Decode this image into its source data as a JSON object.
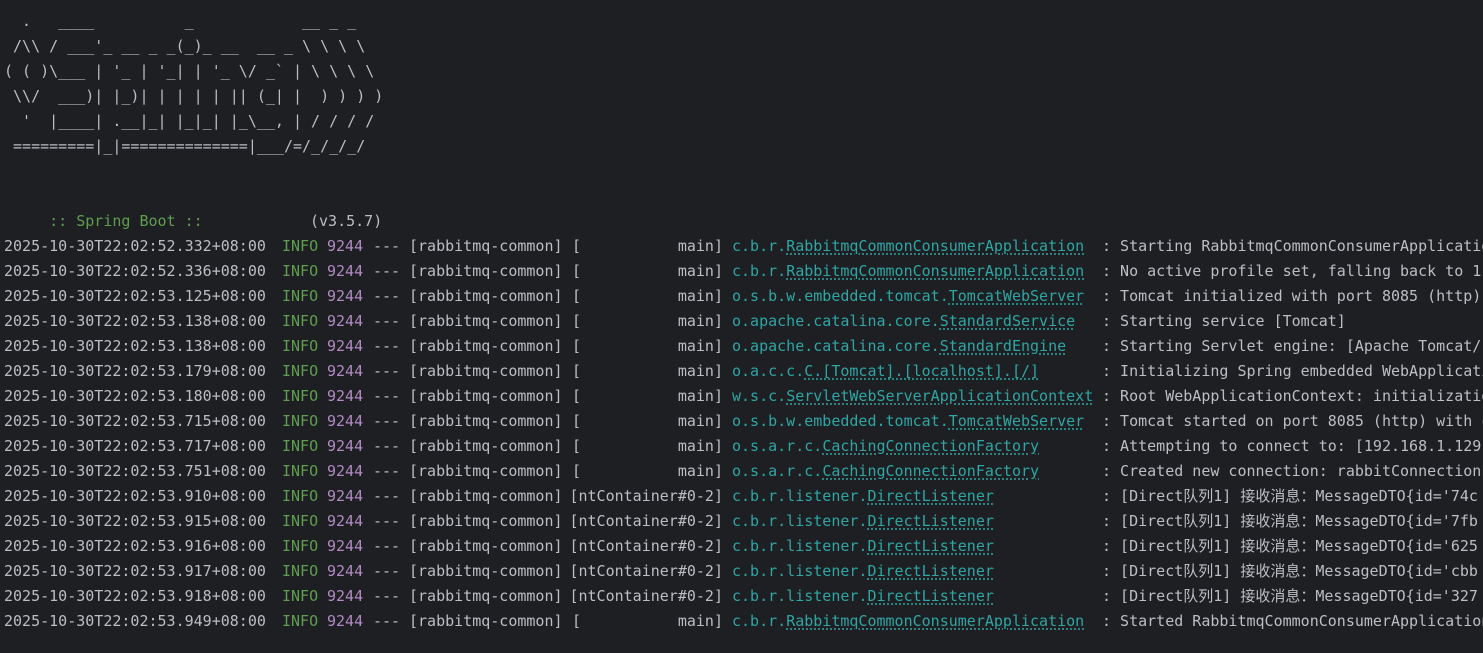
{
  "banner": {
    "art_lines": [
      "  .   ____          _            __ _ _",
      " /\\\\ / ___'_ __ _ _(_)_ __  __ _ \\ \\ \\ \\",
      "( ( )\\___ | '_ | '_| | '_ \\/ _` | \\ \\ \\ \\",
      " \\\\/  ___)| |_)| | | | | || (_| |  ) ) ) )",
      "  '  |____| .__|_| |_|_| |_\\__, | / / / /",
      " =========|_|==============|___/=/_/_/_/"
    ],
    "boot_label": " :: Spring Boot ::",
    "boot_version": "(v3.5.7)"
  },
  "colors": {
    "background": "#1e1f22",
    "default_text": "#bcbec4",
    "level_info": "#5f9e4f",
    "pid": "#b389c5",
    "logger": "#2fa5a5"
  },
  "log": {
    "rows": [
      {
        "ts": "2025-10-30T22:02:52.332+08:00",
        "level": "INFO",
        "pid": "9244",
        "sep": "---",
        "app": "[rabbitmq-common]",
        "thread_open": "[",
        "thread_name": "main]",
        "logger_pkg": "c.b.r.",
        "logger_class": "RabbitmqCommonConsumerApplication",
        "message": ": Starting RabbitmqCommonConsumerApplicatio"
      },
      {
        "ts": "2025-10-30T22:02:52.336+08:00",
        "level": "INFO",
        "pid": "9244",
        "sep": "---",
        "app": "[rabbitmq-common]",
        "thread_open": "[",
        "thread_name": "main]",
        "logger_pkg": "c.b.r.",
        "logger_class": "RabbitmqCommonConsumerApplication",
        "message": ": No active profile set, falling back to 1"
      },
      {
        "ts": "2025-10-30T22:02:53.125+08:00",
        "level": "INFO",
        "pid": "9244",
        "sep": "---",
        "app": "[rabbitmq-common]",
        "thread_open": "[",
        "thread_name": "main]",
        "logger_pkg": "o.s.b.w.embedded.tomcat.",
        "logger_class": "TomcatWebServer",
        "message": ": Tomcat initialized with port 8085 (http)"
      },
      {
        "ts": "2025-10-30T22:02:53.138+08:00",
        "level": "INFO",
        "pid": "9244",
        "sep": "---",
        "app": "[rabbitmq-common]",
        "thread_open": "[",
        "thread_name": "main]",
        "logger_pkg": "o.apache.catalina.core.",
        "logger_class": "StandardService",
        "message": ": Starting service [Tomcat]"
      },
      {
        "ts": "2025-10-30T22:02:53.138+08:00",
        "level": "INFO",
        "pid": "9244",
        "sep": "---",
        "app": "[rabbitmq-common]",
        "thread_open": "[",
        "thread_name": "main]",
        "logger_pkg": "o.apache.catalina.core.",
        "logger_class": "StandardEngine",
        "message": ": Starting Servlet engine: [Apache Tomcat/1"
      },
      {
        "ts": "2025-10-30T22:02:53.179+08:00",
        "level": "INFO",
        "pid": "9244",
        "sep": "---",
        "app": "[rabbitmq-common]",
        "thread_open": "[",
        "thread_name": "main]",
        "logger_pkg": "o.a.c.c.",
        "logger_class": "C.[Tomcat].[localhost].[/]",
        "message": ": Initializing Spring embedded WebApplicati"
      },
      {
        "ts": "2025-10-30T22:02:53.180+08:00",
        "level": "INFO",
        "pid": "9244",
        "sep": "---",
        "app": "[rabbitmq-common]",
        "thread_open": "[",
        "thread_name": "main]",
        "logger_pkg": "w.s.c.",
        "logger_class": "ServletWebServerApplicationContext",
        "message": ": Root WebApplicationContext: initializatio"
      },
      {
        "ts": "2025-10-30T22:02:53.715+08:00",
        "level": "INFO",
        "pid": "9244",
        "sep": "---",
        "app": "[rabbitmq-common]",
        "thread_open": "[",
        "thread_name": "main]",
        "logger_pkg": "o.s.b.w.embedded.tomcat.",
        "logger_class": "TomcatWebServer",
        "message": ": Tomcat started on port 8085 (http) with c"
      },
      {
        "ts": "2025-10-30T22:02:53.717+08:00",
        "level": "INFO",
        "pid": "9244",
        "sep": "---",
        "app": "[rabbitmq-common]",
        "thread_open": "[",
        "thread_name": "main]",
        "logger_pkg": "o.s.a.r.c.",
        "logger_class": "CachingConnectionFactory",
        "message": ": Attempting to connect to: [192.168.1.129:"
      },
      {
        "ts": "2025-10-30T22:02:53.751+08:00",
        "level": "INFO",
        "pid": "9244",
        "sep": "---",
        "app": "[rabbitmq-common]",
        "thread_open": "[",
        "thread_name": "main]",
        "logger_pkg": "o.s.a.r.c.",
        "logger_class": "CachingConnectionFactory",
        "message": ": Created new connection: rabbitConnectionF"
      },
      {
        "ts": "2025-10-30T22:02:53.910+08:00",
        "level": "INFO",
        "pid": "9244",
        "sep": "---",
        "app": "[rabbitmq-common]",
        "thread_open": "",
        "thread_name": "[ntContainer#0-2]",
        "logger_pkg": "c.b.r.listener.",
        "logger_class": "DirectListener",
        "message": ": [Direct队列1] 接收消息：MessageDTO{id='74c"
      },
      {
        "ts": "2025-10-30T22:02:53.915+08:00",
        "level": "INFO",
        "pid": "9244",
        "sep": "---",
        "app": "[rabbitmq-common]",
        "thread_open": "",
        "thread_name": "[ntContainer#0-2]",
        "logger_pkg": "c.b.r.listener.",
        "logger_class": "DirectListener",
        "message": ": [Direct队列1] 接收消息：MessageDTO{id='7fb"
      },
      {
        "ts": "2025-10-30T22:02:53.916+08:00",
        "level": "INFO",
        "pid": "9244",
        "sep": "---",
        "app": "[rabbitmq-common]",
        "thread_open": "",
        "thread_name": "[ntContainer#0-2]",
        "logger_pkg": "c.b.r.listener.",
        "logger_class": "DirectListener",
        "message": ": [Direct队列1] 接收消息：MessageDTO{id='625"
      },
      {
        "ts": "2025-10-30T22:02:53.917+08:00",
        "level": "INFO",
        "pid": "9244",
        "sep": "---",
        "app": "[rabbitmq-common]",
        "thread_open": "",
        "thread_name": "[ntContainer#0-2]",
        "logger_pkg": "c.b.r.listener.",
        "logger_class": "DirectListener",
        "message": ": [Direct队列1] 接收消息：MessageDTO{id='cbb"
      },
      {
        "ts": "2025-10-30T22:02:53.918+08:00",
        "level": "INFO",
        "pid": "9244",
        "sep": "---",
        "app": "[rabbitmq-common]",
        "thread_open": "",
        "thread_name": "[ntContainer#0-2]",
        "logger_pkg": "c.b.r.listener.",
        "logger_class": "DirectListener",
        "message": ": [Direct队列1] 接收消息：MessageDTO{id='327"
      },
      {
        "ts": "2025-10-30T22:02:53.949+08:00",
        "level": "INFO",
        "pid": "9244",
        "sep": "---",
        "app": "[rabbitmq-common]",
        "thread_open": "[",
        "thread_name": "main]",
        "logger_pkg": "c.b.r.",
        "logger_class": "RabbitmqCommonConsumerApplication",
        "message": ": Started RabbitmqCommonConsumerApplication"
      }
    ]
  }
}
